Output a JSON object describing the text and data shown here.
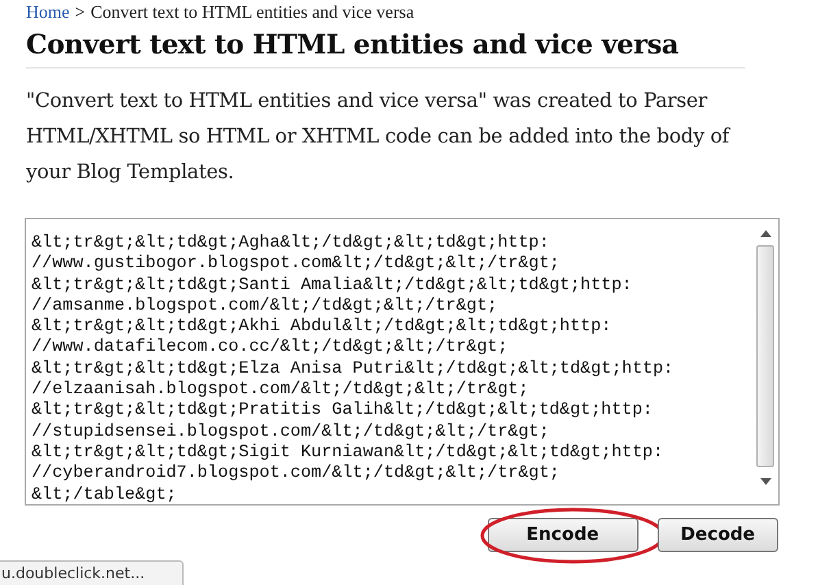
{
  "breadcrumb": {
    "link": "Home",
    "separator": ">",
    "current": "Convert text to HTML entities and vice versa"
  },
  "title": "Convert text to HTML entities and vice versa",
  "description": "\"Convert text to HTML entities and vice versa\" was created to Parser HTML/XHTML so HTML or XHTML code can be added into the body of your Blog Templates.",
  "textarea": {
    "lines": [
      "&lt;tr&gt;&lt;td&gt;Agha&lt;/td&gt;&lt;td&gt;http:",
      "//www.gustibogor.blogspot.com&lt;/td&gt;&lt;/tr&gt;",
      "&lt;tr&gt;&lt;td&gt;Santi Amalia&lt;/td&gt;&lt;td&gt;http:",
      "//amsanme.blogspot.com/&lt;/td&gt;&lt;/tr&gt;",
      "&lt;tr&gt;&lt;td&gt;Akhi Abdul&lt;/td&gt;&lt;td&gt;http:",
      "//www.datafilecom.co.cc/&lt;/td&gt;&lt;/tr&gt;",
      "&lt;tr&gt;&lt;td&gt;Elza Anisa Putri&lt;/td&gt;&lt;td&gt;http:",
      "//elzaanisah.blogspot.com/&lt;/td&gt;&lt;/tr&gt;",
      "&lt;tr&gt;&lt;td&gt;Pratitis Galih&lt;/td&gt;&lt;td&gt;http:",
      "//stupidsensei.blogspot.com/&lt;/td&gt;&lt;/tr&gt;",
      "&lt;tr&gt;&lt;td&gt;Sigit Kurniawan&lt;/td&gt;&lt;td&gt;http:",
      "//cyberandroid7.blogspot.com/&lt;/td&gt;&lt;/tr&gt;",
      "&lt;/table&gt;"
    ]
  },
  "buttons": [
    {
      "label": "Encode",
      "highlighted": true
    },
    {
      "label": "Decode",
      "highlighted": false
    }
  ],
  "status_tooltip": "u.doubleclick.net..."
}
